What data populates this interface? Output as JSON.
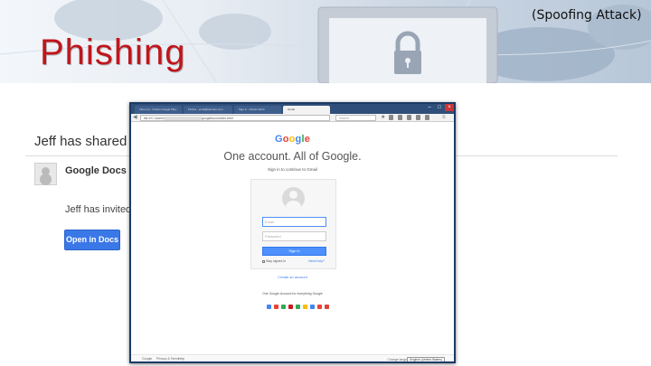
{
  "slide": {
    "title": "Phishing",
    "subtitle": "(Spoofing Attack)",
    "title_color": "#c0161c"
  },
  "email": {
    "title": "Jeff has shared a c",
    "sender": "Google Docs",
    "body": "Jeff has invited y",
    "button": "Open in Docs"
  },
  "browser": {
    "tabs": [
      {
        "label": "Inbox (1) - Firefox Google Play..."
      },
      {
        "label": "Firefox - email@domain.com..."
      },
      {
        "label": "Sign in - Adobe Flash"
      },
      {
        "label": "Gmail",
        "active": true
      }
    ],
    "url_prefix": "file:///C:/Users/",
    "url_suffix": "/googledocs/index.html",
    "search_placeholder": "Search",
    "page": {
      "logo": [
        "G",
        "o",
        "o",
        "g",
        "l",
        "e"
      ],
      "logo_colors": [
        "#4285f4",
        "#ea4335",
        "#fbbc05",
        "#4285f4",
        "#34a853",
        "#ea4335"
      ],
      "heading": "One account. All of Google.",
      "sub": "Sign in to continue to Gmail",
      "email_placeholder": "Email",
      "password_placeholder": "Password",
      "signin": "Sign in",
      "stay": "Stay signed in",
      "help": "Need help?",
      "create": "Create an account",
      "one_account": "One Google Account for everything Google",
      "app_icons": [
        "google-icon",
        "gmail-icon",
        "maps-icon",
        "youtube-icon",
        "play-icon",
        "drive-icon",
        "search-icon",
        "photos-icon",
        "chrome-icon"
      ],
      "app_colors": [
        "#4285f4",
        "#ea4335",
        "#34a853",
        "#cc181e",
        "#34a853",
        "#fbbc05",
        "#4285f4",
        "#ea4335",
        "#db4437"
      ],
      "footer": [
        "Google",
        "Privacy & Terms",
        "Help"
      ],
      "language_label": "Change language",
      "language": "English (United States)"
    }
  }
}
